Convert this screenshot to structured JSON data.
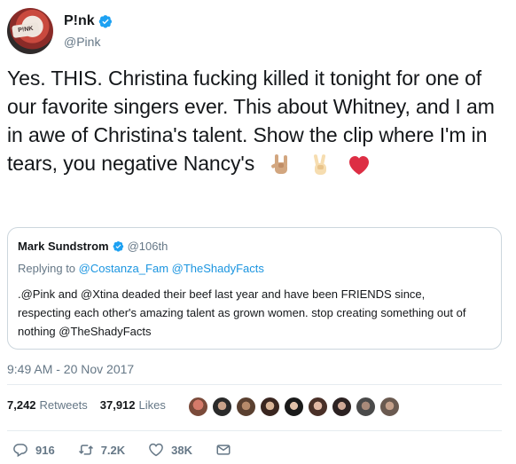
{
  "author": {
    "display_name": "P!nk",
    "handle": "@Pink",
    "avatar_text": "P!NK"
  },
  "tweet": {
    "text": "Yes. THIS. Christina fucking killed it tonight for one of our favorite singers ever. This about Whitney, and I am in awe of Christina's talent.  Show the clip where I'm in tears, you negative Nancy's",
    "emojis": [
      "sign-of-the-horns-emoji",
      "victory-hand-emoji",
      "red-heart-emoji"
    ]
  },
  "quote": {
    "display_name": "Mark Sundstrom",
    "handle": "@106th",
    "reply_prefix": "Replying to",
    "reply_to_1": "@Costanza_Fam",
    "reply_to_2": "@TheShadyFacts",
    "text": ".@Pink and @Xtina deaded their beef last year and have been FRIENDS since, respecting each other's amazing talent as grown women. stop creating something out of nothing @TheShadyFacts"
  },
  "timestamp": "9:49 AM - 20 Nov 2017",
  "stats": {
    "retweets_count": "7,242",
    "retweets_label": "Retweets",
    "likes_count": "37,912",
    "likes_label": "Likes"
  },
  "actions": {
    "reply_count": "916",
    "retweet_count": "7.2K",
    "like_count": "38K"
  },
  "colors": {
    "verified": "#1da1f2",
    "link": "#1b95e0",
    "muted": "#657786",
    "heart": "#e0245e"
  }
}
